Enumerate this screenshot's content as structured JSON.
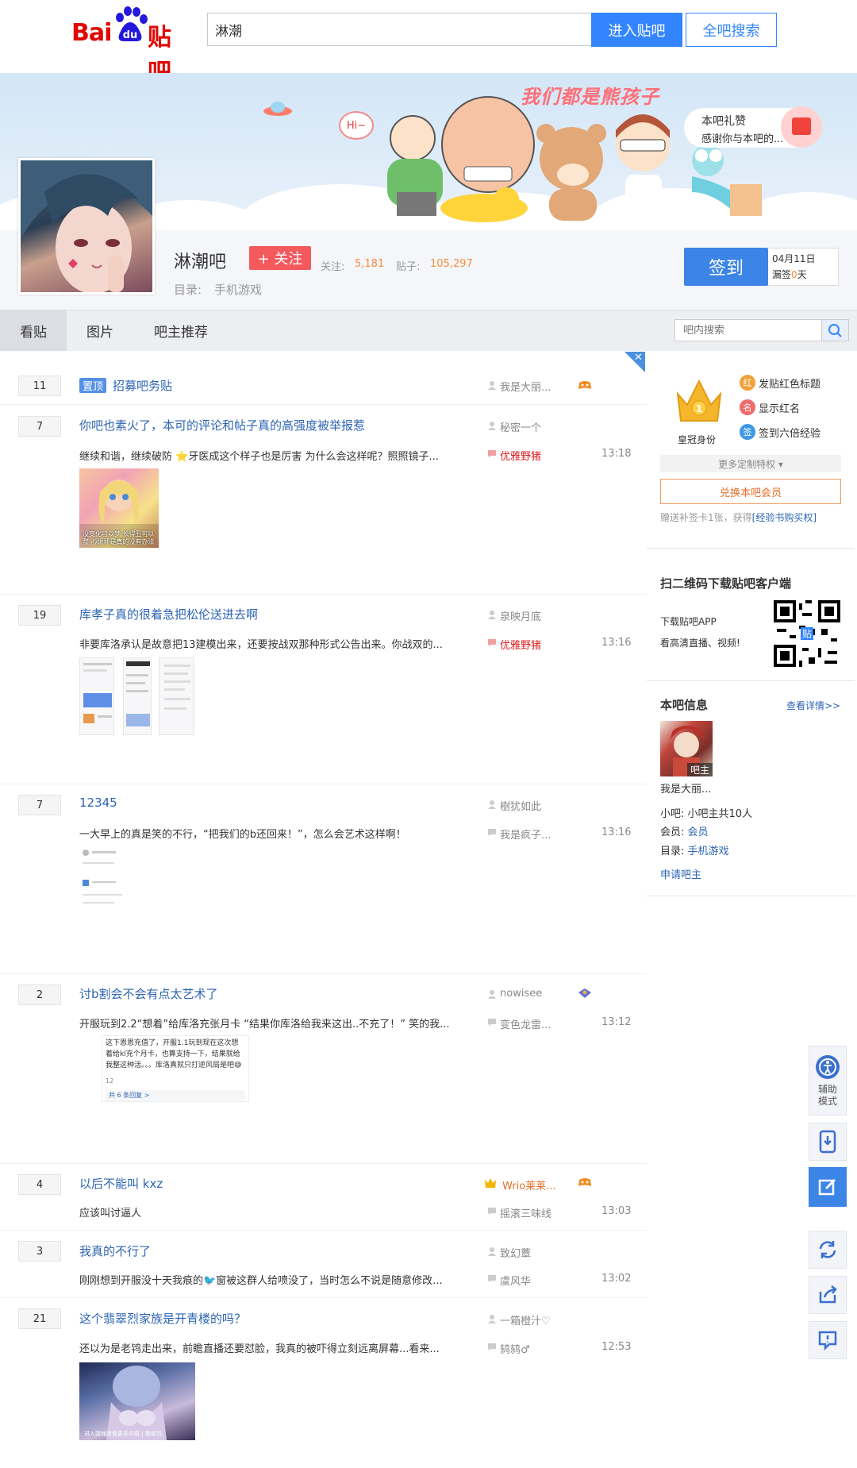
{
  "header": {
    "logo_text": "Bai du 贴吧",
    "logo_part1": "Bai",
    "logo_part2": "贴吧",
    "search_value": "淋潮",
    "enter_button": "进入贴吧",
    "search_all_button": "全吧搜索"
  },
  "banner": {
    "slogan": "我们都是熊孩子",
    "hi_text": "Hi~",
    "gift_title": "本吧礼赞",
    "gift_subtitle": "感谢你与本吧的..."
  },
  "bar": {
    "name": "淋潮吧",
    "follow_button": "+ 关注",
    "follow_label": "关注:",
    "follow_count": "5,181",
    "posts_label": "贴子:",
    "posts_count": "105,297",
    "directory_label": "目录:",
    "directory_value": "手机游戏",
    "sign_button": "签到",
    "sign_date": "04月11日",
    "sign_missed_prefix": "漏签",
    "sign_missed_days": "0",
    "sign_missed_suffix": "天"
  },
  "tabs": [
    {
      "label": "看贴",
      "active": true
    },
    {
      "label": "图片",
      "active": false
    },
    {
      "label": "吧主推荐",
      "active": false
    }
  ],
  "in_bar_search": {
    "placeholder": "吧内搜索"
  },
  "threads": [
    {
      "replies": "11",
      "pinned": true,
      "pin_label": "置顶",
      "title": "招募吧务贴",
      "author": "我是大丽...",
      "excerpt": "",
      "last_reply": "",
      "time": ""
    },
    {
      "replies": "7",
      "title": "你吧也素火了，本可的评论和帖子真的高强度被举报惹",
      "author": "秘密一个",
      "excerpt": "继续和谐，继续破防 ⭐牙医成这个样子也是厉害 为什么会这样呢？照照镜子...",
      "last_reply": "优雅野猪",
      "time": "13:18",
      "image_text": "没变化可以梦 长得丑可以整 心眼坏是真的没有办法"
    },
    {
      "replies": "19",
      "title": "库孝子真的很着急把松伦送进去啊",
      "author": "泉映月底",
      "excerpt": "非要库洛承认是故意把13建模出来，还要按战双那种形式公告出来。你战双的...",
      "last_reply": "优雅野猪",
      "time": "13:16"
    },
    {
      "replies": "7",
      "title": "12345",
      "author": "樹犹如此",
      "excerpt": "一大早上的真是笑的不行，“把我们的b还回来！”，怎么会艺术这样啊！",
      "last_reply": "我是疯子...",
      "time": "13:16"
    },
    {
      "replies": "2",
      "title": "讨b割会不会有点太艺术了",
      "author": "nowisee",
      "excerpt": "开服玩到2.2“想着”给库洛充张月卡 “结果你库洛给我来这出..不充了！” 笑的我...",
      "last_reply": "变色龙雷...",
      "time": "13:12",
      "image_text": "这下恩恩充值了，开服1.1玩到现在这次想着给kl充个月卡，也算支持一下，结果就给我整这种活。。。库洛真就只打逆风局是吧😅",
      "image_footer": "共 6 条回复 >",
      "image_likes": "12"
    },
    {
      "replies": "4",
      "title": "以后不能叫 kxz",
      "author": "Wrio莱莱...",
      "excerpt": "应该叫讨逼人",
      "last_reply": "摇滚三味线",
      "time": "13:03"
    },
    {
      "replies": "3",
      "title": "我真的不行了",
      "author": "致幻蕈",
      "excerpt": "刚刚想到开服没十天我痕的🐦窗被这群人给喷没了，当时怎么不说是随意修改...",
      "last_reply": "虞风华",
      "time": "13:02"
    },
    {
      "replies": "21",
      "title": "这个翡翠烈家族是开青楼的吗？",
      "author": "一箱橙汁♡",
      "excerpt": "还以为是老鸨走出来，前瞻直播还要怼脸，我真的被吓得立刻远离屏幕...看来...",
      "last_reply": "鸫鸫♂",
      "time": "12:53",
      "image_text": "进入游戏查看更多内容 | 翡翠烈"
    }
  ],
  "sidebar": {
    "crown_label": "皇冠身份",
    "privileges": [
      "发贴红色标题",
      "显示红名",
      "签到六倍经验"
    ],
    "privilege_icons": [
      "红",
      "名",
      "签"
    ],
    "more_privileges": "更多定制特权 ▾",
    "exchange_button": "兑换本吧会员",
    "note_prefix": "赠送补签卡1张，获得",
    "note_link": "[经验书购买权]",
    "app_title": "扫二维码下载贴吧客户端",
    "app_line1": "下载贴吧APP",
    "app_line2": "看高清直播、视频!",
    "qr_badge": "贴",
    "info_title": "本吧信息",
    "info_link": "查看详情>>",
    "owner_tag": "吧主",
    "owner_name": "我是大丽...",
    "small_owner_label": "小吧:",
    "small_owner_value": "小吧主共10人",
    "member_label": "会员:",
    "member_value": "会员",
    "directory_label": "目录:",
    "directory_value": "手机游戏",
    "apply_link": "申请吧主"
  },
  "floating_tools": {
    "assist_label": "辅助模式"
  },
  "colors": {
    "brand_blue": "#3385ff",
    "link_blue": "#2d64b3",
    "follow_red": "#f4595e",
    "count_orange": "#f78b3d",
    "sign_blue": "#3c84e6"
  }
}
